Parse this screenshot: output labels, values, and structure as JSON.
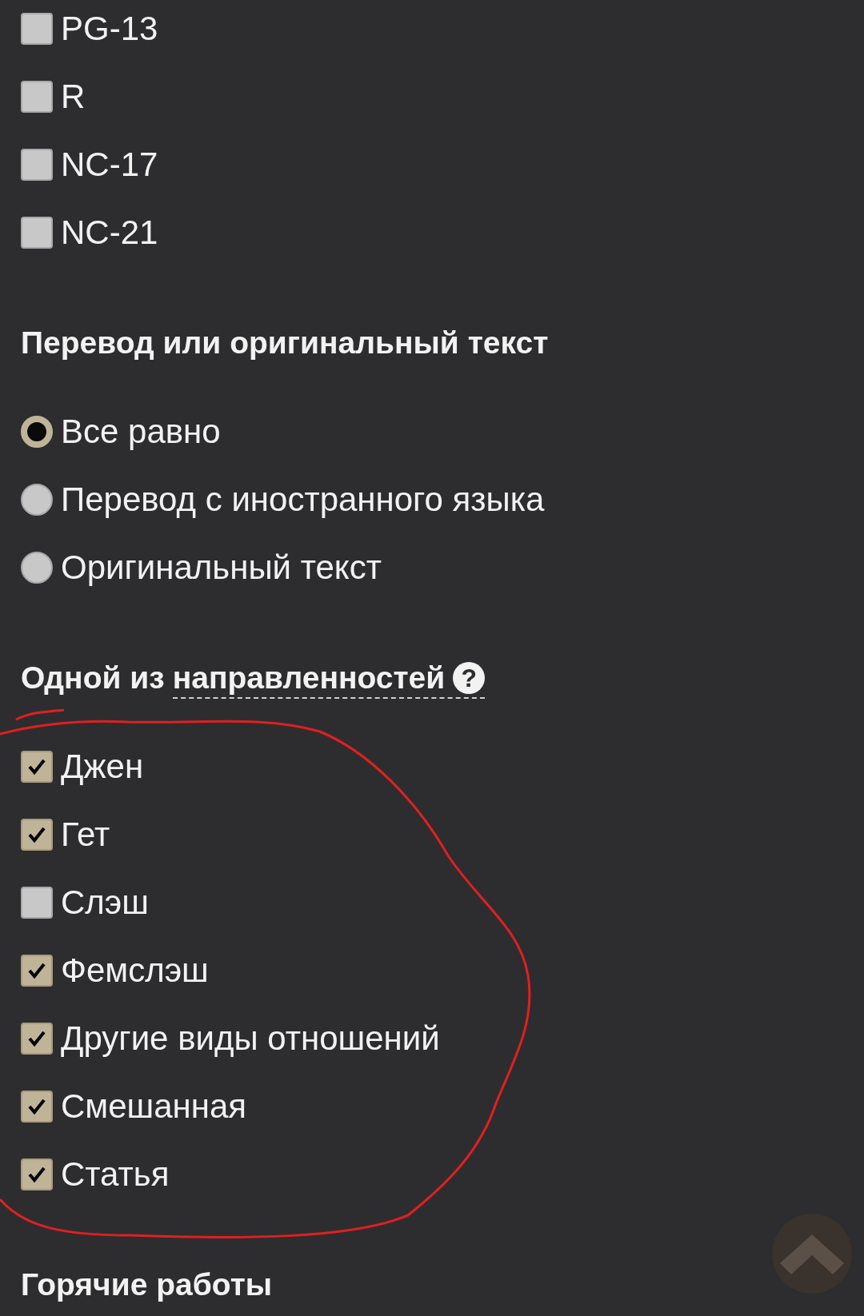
{
  "ratings": [
    {
      "label": "PG-13",
      "checked": false
    },
    {
      "label": "R",
      "checked": false
    },
    {
      "label": "NC-17",
      "checked": false
    },
    {
      "label": "NC-21",
      "checked": false
    }
  ],
  "translation": {
    "title": "Перевод или оригинальный текст",
    "options": [
      {
        "label": "Все равно",
        "selected": true
      },
      {
        "label": "Перевод с иностранного языка",
        "selected": false
      },
      {
        "label": "Оригинальный текст",
        "selected": false
      }
    ]
  },
  "directions": {
    "title": "Одной из",
    "help_term": "направленностей",
    "help_icon": "?",
    "options": [
      {
        "label": "Джен",
        "checked": true
      },
      {
        "label": "Гет",
        "checked": true
      },
      {
        "label": "Слэш",
        "checked": false
      },
      {
        "label": "Фемслэш",
        "checked": true
      },
      {
        "label": "Другие виды отношений",
        "checked": true
      },
      {
        "label": "Смешанная",
        "checked": true
      },
      {
        "label": "Статья",
        "checked": true
      }
    ]
  },
  "hot_works": {
    "title": "Горячие работы"
  }
}
